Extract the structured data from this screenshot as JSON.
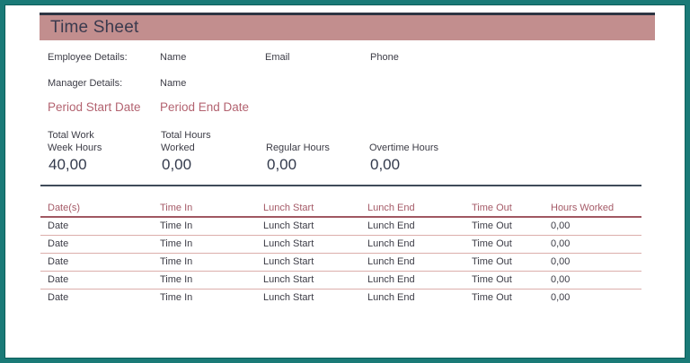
{
  "title": "Time Sheet",
  "colors": {
    "frame_teal": "#1a7a77",
    "band_rose": "#c28e8e",
    "band_top_line": "#2d3442",
    "accent_rose_text": "#b36370",
    "table_header_text": "#a55a67",
    "thick_rule": "#a05862",
    "thin_rule": "#dcaeab",
    "totals_rule": "#3f4b59",
    "dark_text": "#3c3c46"
  },
  "employee": {
    "label": "Employee Details:",
    "name_label": "Name",
    "email_label": "Email",
    "phone_label": "Phone"
  },
  "manager": {
    "label": "Manager Details:",
    "name_label": "Name"
  },
  "period": {
    "start_label": "Period Start Date",
    "end_label": "Period End Date"
  },
  "totals": {
    "cols": [
      {
        "label1": "Total Work",
        "label2": "Week Hours",
        "value": "40,00"
      },
      {
        "label1": "Total Hours",
        "label2": "Worked",
        "value": "0,00"
      },
      {
        "label1": "",
        "label2": "Regular Hours",
        "value": "0,00"
      },
      {
        "label1": "",
        "label2": "Overtime Hours",
        "value": "0,00"
      }
    ]
  },
  "table": {
    "headers": [
      "Date(s)",
      "Time In",
      "Lunch Start",
      "Lunch End",
      "Time Out",
      "Hours Worked"
    ],
    "rows": [
      [
        "Date",
        "Time In",
        "Lunch Start",
        "Lunch End",
        "Time Out",
        "0,00"
      ],
      [
        "Date",
        "Time In",
        "Lunch Start",
        "Lunch End",
        "Time Out",
        "0,00"
      ],
      [
        "Date",
        "Time In",
        "Lunch Start",
        "Lunch End",
        "Time Out",
        "0,00"
      ],
      [
        "Date",
        "Time In",
        "Lunch Start",
        "Lunch End",
        "Time Out",
        "0,00"
      ],
      [
        "Date",
        "Time In",
        "Lunch Start",
        "Lunch End",
        "Time Out",
        "0,00"
      ]
    ]
  }
}
